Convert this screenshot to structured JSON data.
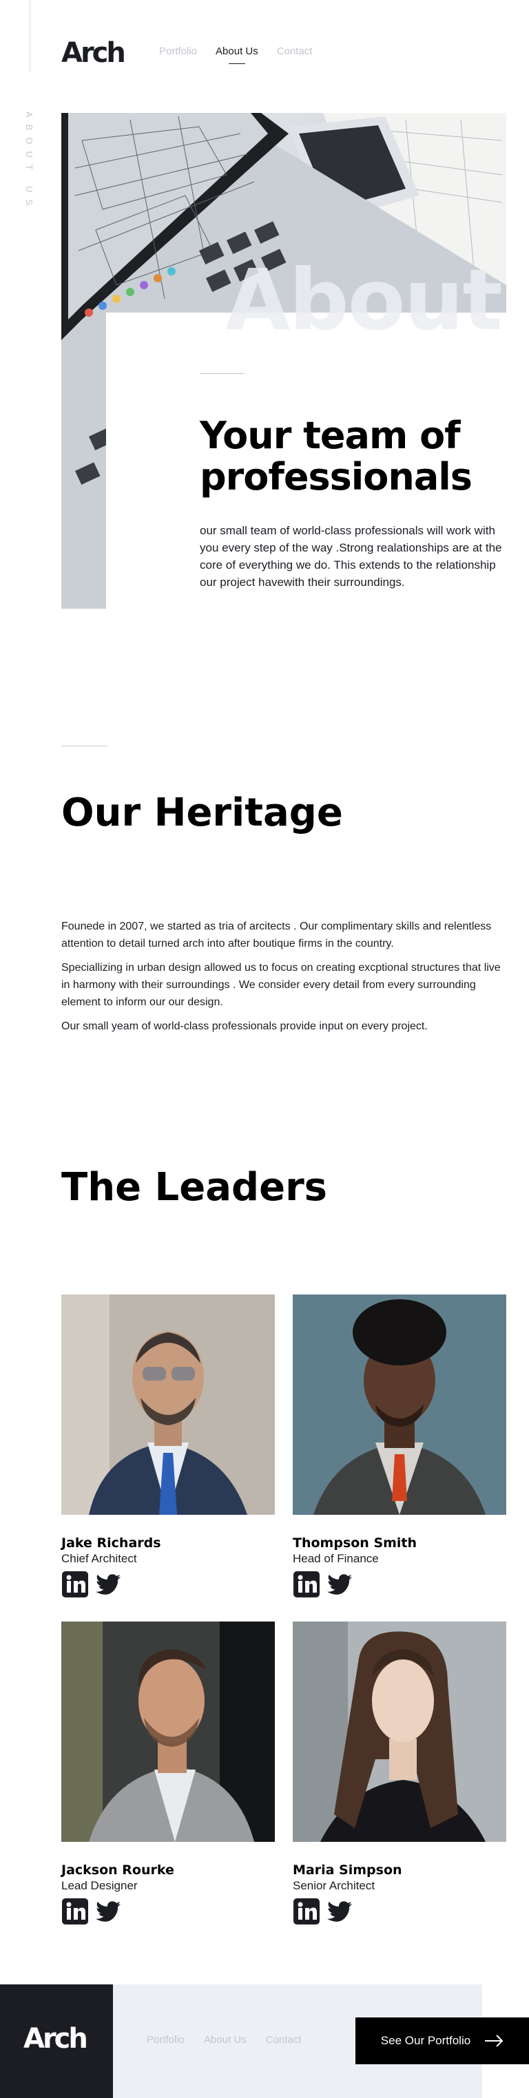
{
  "header": {
    "logo": "Arch",
    "nav": [
      {
        "label": "Portfolio",
        "active": false
      },
      {
        "label": "About Us",
        "active": true
      },
      {
        "label": "Contact",
        "active": false
      }
    ],
    "vertical_label": "About Us"
  },
  "hero": {
    "bg_word": "About",
    "heading": "Your team of professionals",
    "text": "our small team of world-class professionals will work with you every step of the way .Strong realationships are at the core of everything we do. This extends to the relationship our project havewith their surroundings."
  },
  "heritage": {
    "heading": "Our Heritage",
    "paragraphs": [
      "Founede in 2007, we started as tria of arcitects . Our complimentary skills and relentless attention to detail turned arch into after boutique firms in the country.",
      "Speciallizing in urban design allowed us to focus on creating excptional structures that live in harmony with their surroundings . We consider every detail from every surrounding element to inform our our design.",
      "Our small yeam of world-class professionals provide input on every project."
    ]
  },
  "leaders": {
    "heading": "The Leaders",
    "people": [
      {
        "name": "Jake Richards",
        "role": "Chief Architect"
      },
      {
        "name": "Thompson Smith",
        "role": "Head of Finance"
      },
      {
        "name": "Jackson Rourke",
        "role": "Lead Designer"
      },
      {
        "name": "Maria Simpson",
        "role": "Senior Architect"
      }
    ]
  },
  "footer": {
    "logo": "Arch",
    "nav": [
      "Portfolio",
      "About Us",
      "Contact"
    ],
    "cta_label": "See Our Portfolio"
  },
  "icons": {
    "social": [
      "linkedin-icon",
      "twitter-icon"
    ],
    "cta": "arrow-right-icon"
  },
  "colors": {
    "dark": "#1b1d23",
    "muted": "#c5c6ce",
    "footer_light": "#eeeff4",
    "cta_bg": "#000000"
  }
}
